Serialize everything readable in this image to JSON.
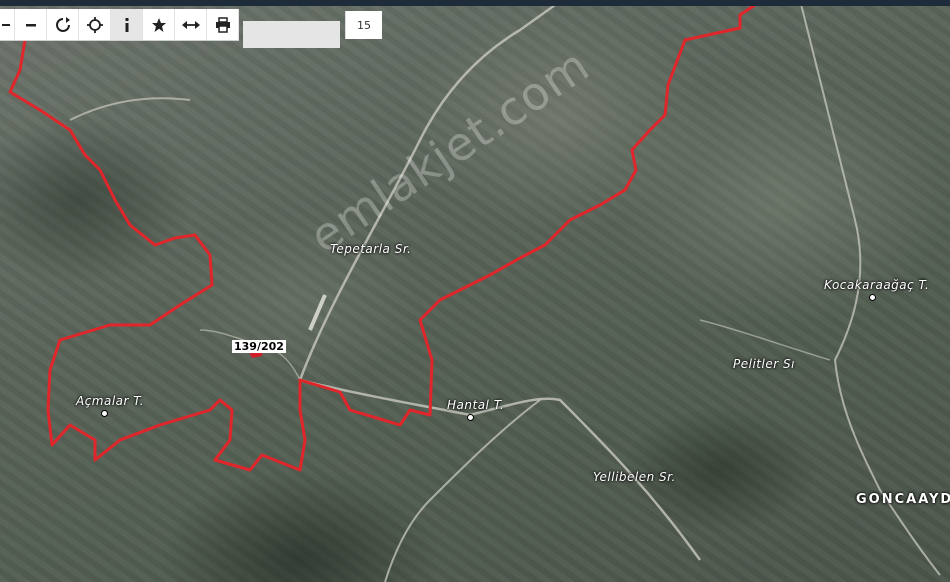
{
  "toolbar": {
    "zoom_value": "15",
    "search_placeholder": ""
  },
  "map": {
    "watermark": "emlakjet.com",
    "parcel_label": "139/202",
    "labels": {
      "tepetarla": "Tepetarla Sr.",
      "kocakaraagac": "Kocakaraağaç T.",
      "pelitler": "Pelitler Sı",
      "acmalar": "Açmalar T.",
      "hantal": "Hantal T.",
      "yellibelen": "Yellibelen Sr.",
      "goncaaydi": "GONCAAYDI"
    },
    "boundary_color": "#e0262b"
  }
}
